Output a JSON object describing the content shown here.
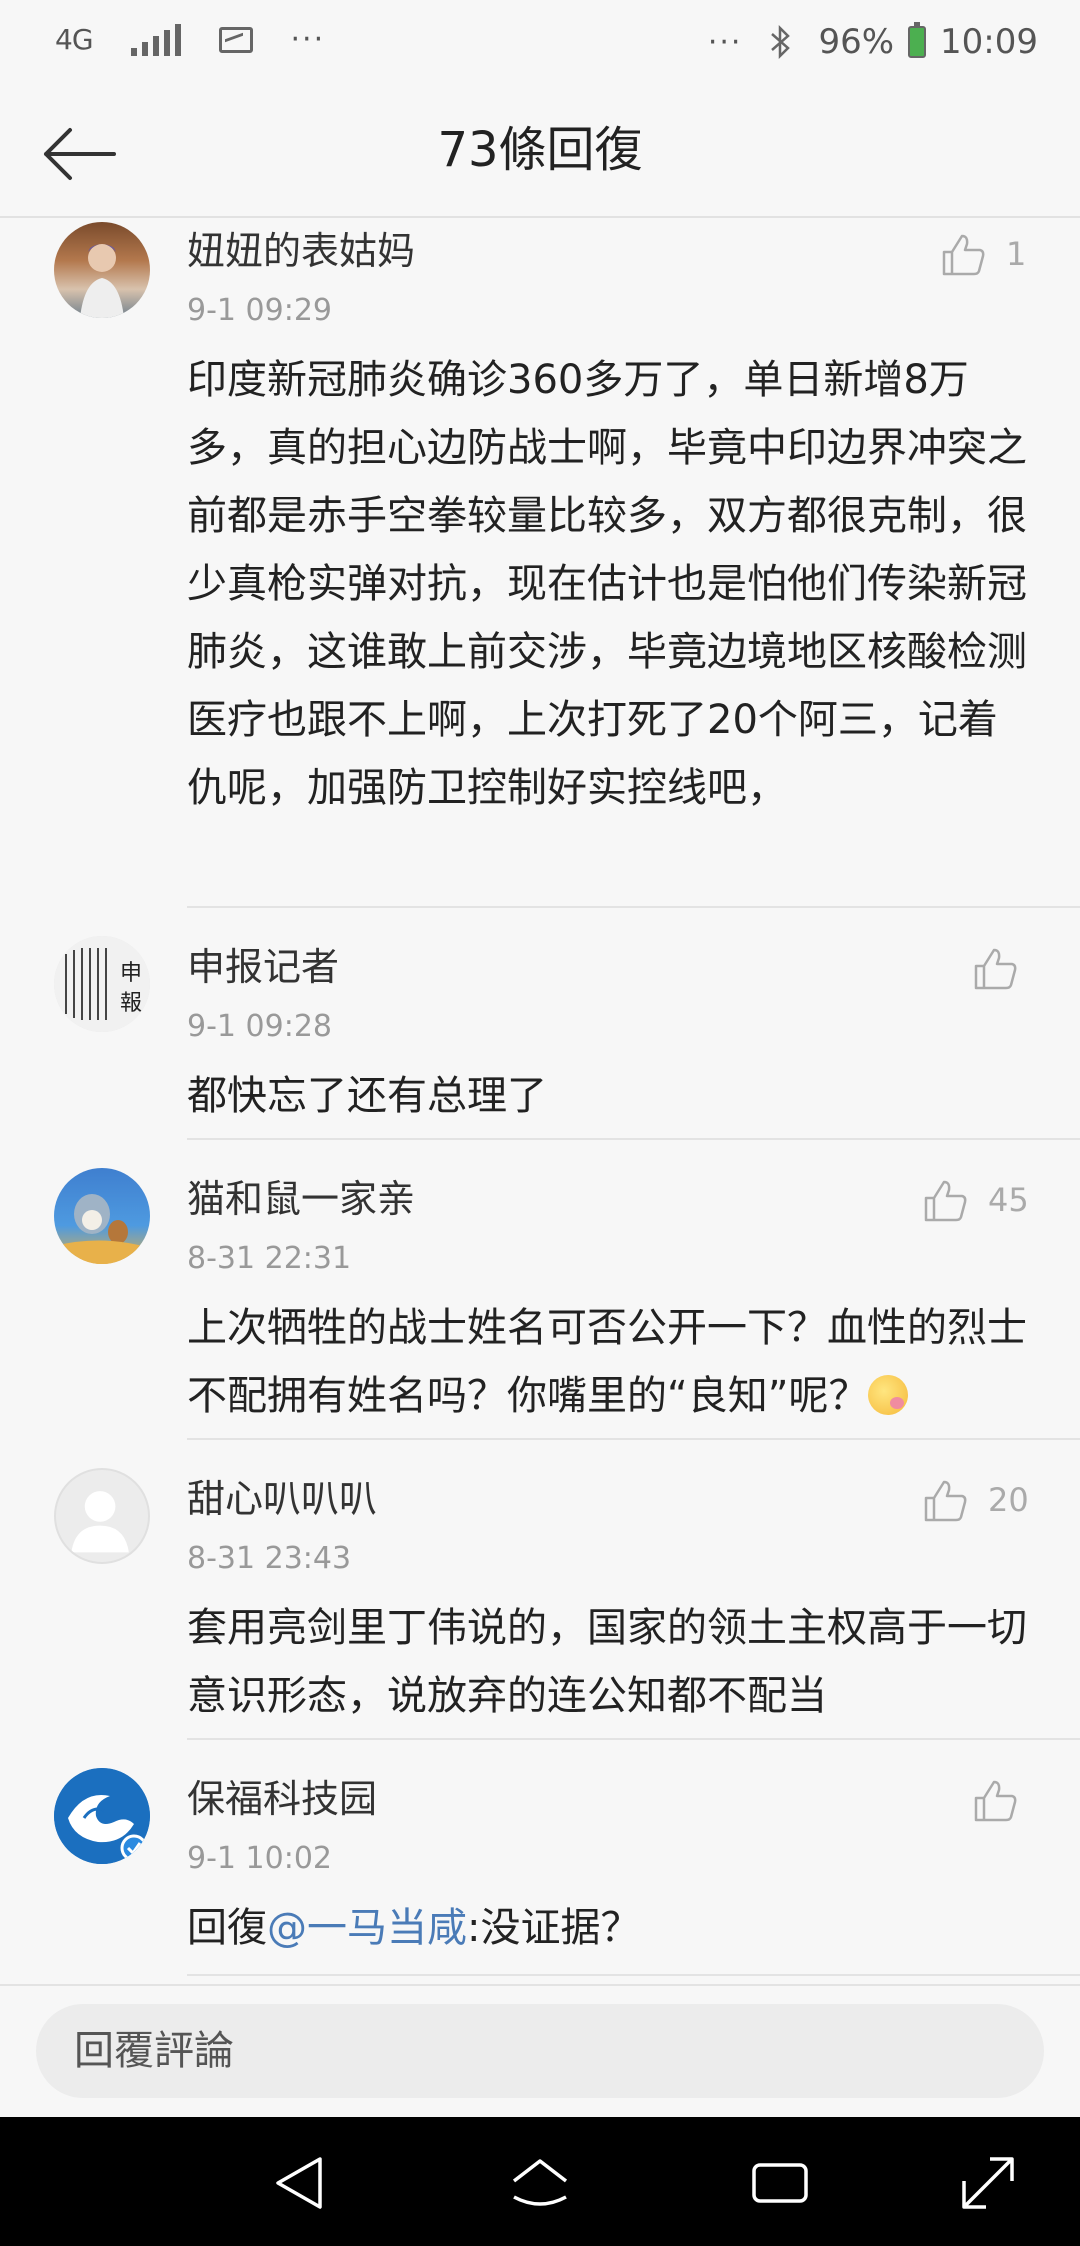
{
  "status_bar": {
    "network": "4G",
    "more": "···",
    "notifications_more": "···",
    "battery": "96%",
    "time": "10:09"
  },
  "header": {
    "title": "73條回復"
  },
  "comments": [
    {
      "name": "妞妞的表姑妈",
      "time": "9-1 09:29",
      "text": "印度新冠肺炎确诊360多万了，单日新增8万多，真的担心边防战士啊，毕竟中印边界冲突之前都是赤手空拳较量比较多，双方都很克制，很少真枪实弹对抗，现在估计也是怕他们传染新冠肺炎，这谁敢上前交涉，毕竟边境地区核酸检测医疗也跟不上啊，上次打死了20个阿三，记着仇呢，加强防卫控制好实控线吧，",
      "likes": "1"
    },
    {
      "name": "申报记者",
      "time": "9-1 09:28",
      "text": "都快忘了还有总理了",
      "likes": ""
    },
    {
      "name": "猫和鼠一家亲",
      "time": "8-31 22:31",
      "text": "上次牺牲的战士姓名可否公开一下？血性的烈士不配拥有姓名吗？你嘴里的“良知”呢？",
      "likes": "45"
    },
    {
      "name": "甜心叭叭叭",
      "time": "8-31 23:43",
      "text": "套用亮剑里丁伟说的，国家的领土主权高于一切意识形态，说放弃的连公知都不配当",
      "likes": "20"
    },
    {
      "name": "保福科技园",
      "time": "9-1 10:02",
      "text_prefix": "回復",
      "mention": "@一马当咸",
      "text_suffix": ":没证据？",
      "likes": ""
    }
  ],
  "reply_input": {
    "placeholder": "回覆評論"
  },
  "icons": {
    "back": "arrow-left-icon",
    "like": "thumbs-up-icon",
    "bluetooth": "bluetooth-icon",
    "battery": "battery-icon",
    "nav_back": "triangle-back-icon",
    "nav_home": "home-icon",
    "nav_recent": "recent-apps-icon",
    "nav_expand": "expand-icon"
  },
  "colors": {
    "mention": "#4a7bb7",
    "battery": "#4caf50"
  }
}
